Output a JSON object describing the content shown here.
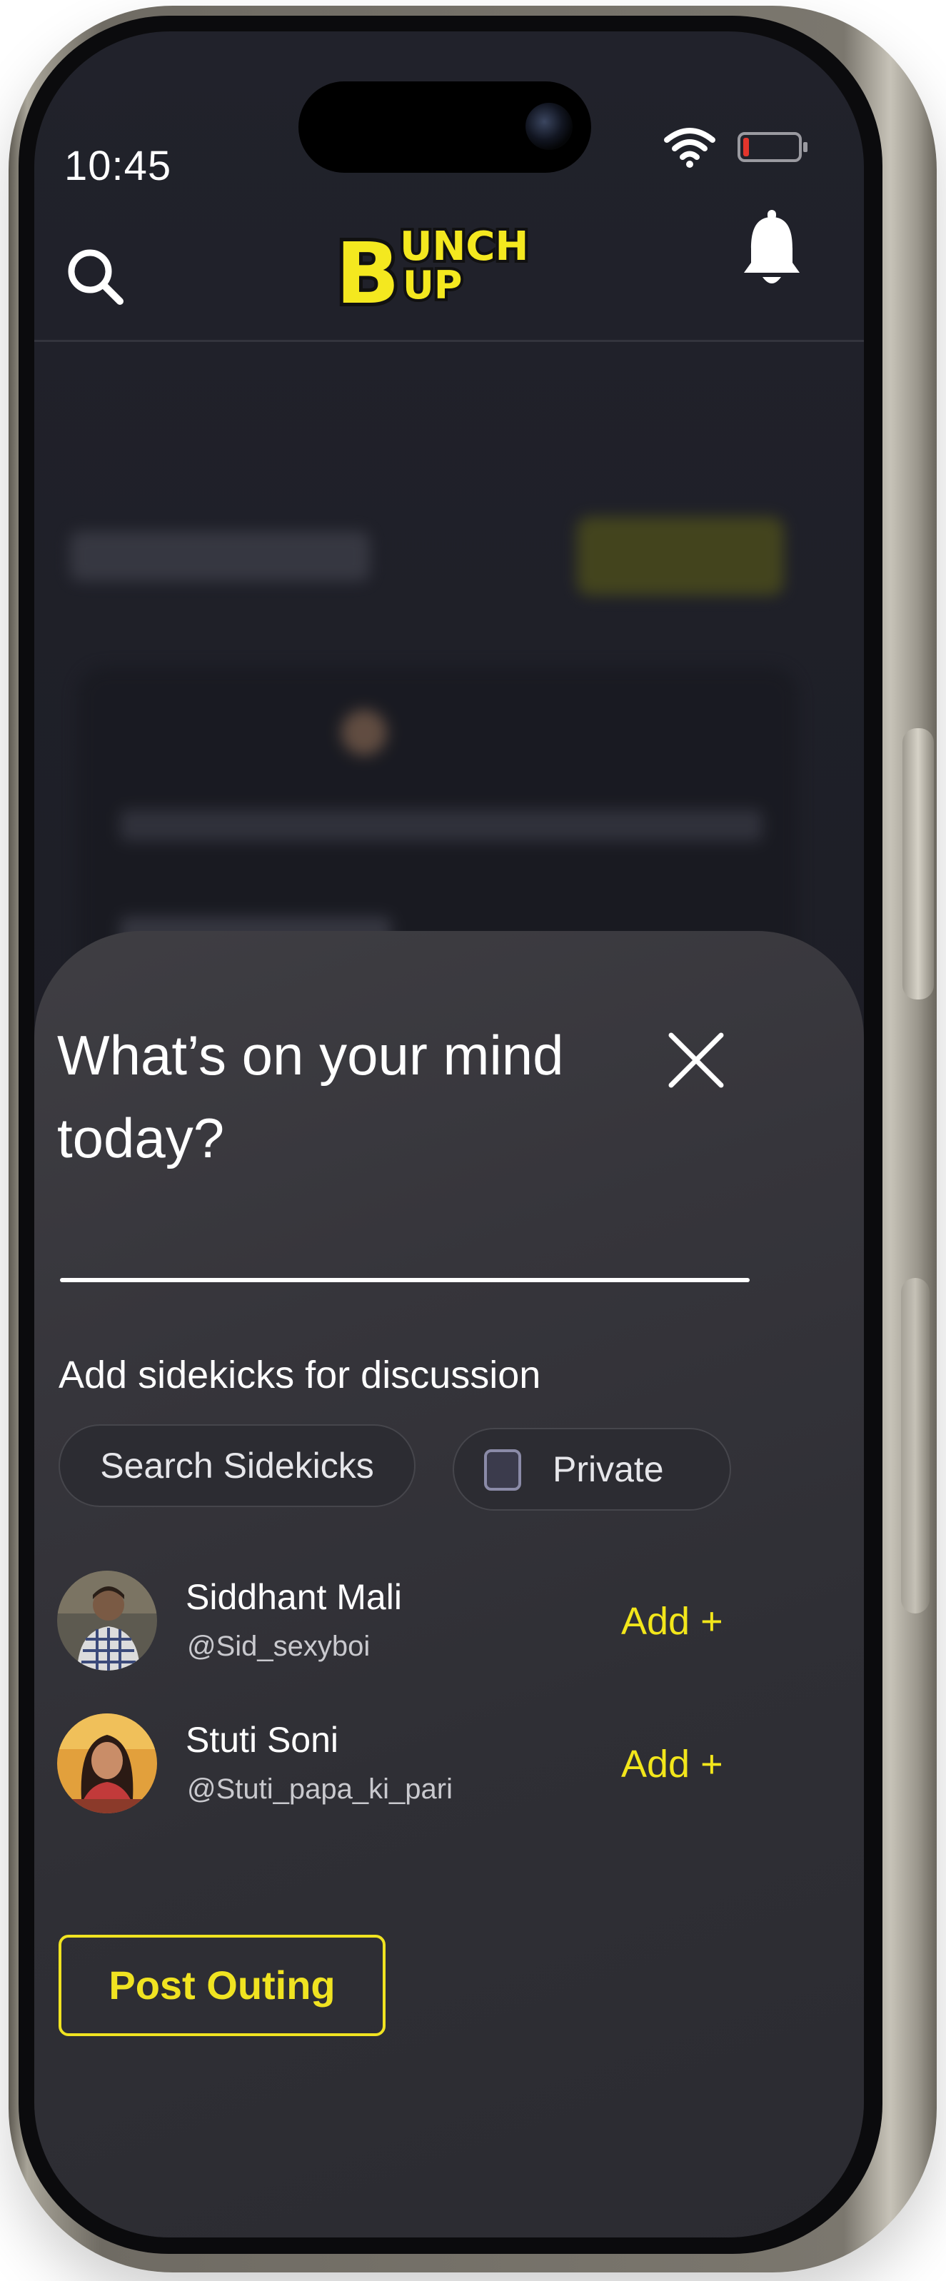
{
  "status_bar": {
    "time": "10:45",
    "icons": [
      "wifi-icon",
      "battery-icon"
    ]
  },
  "header": {
    "logo_text_1": "B",
    "logo_text_2": "UNCH",
    "logo_text_3": "UP",
    "icons": [
      "search-icon",
      "bell-icon"
    ]
  },
  "sheet": {
    "title": "What’s on your mind today?",
    "close_icon": "close-icon",
    "sidekicks_label": "Add sidekicks for discussion",
    "search_placeholder": "Search Sidekicks",
    "private_label": "Private",
    "private_checked": false,
    "sidekicks": [
      {
        "name": "Siddhant Mali",
        "handle": "@Sid_sexyboi",
        "action": "Add +"
      },
      {
        "name": "Stuti Soni",
        "handle": "@Stuti_papa_ki_pari",
        "action": "Add +"
      }
    ],
    "post_button": "Post Outing"
  },
  "colors": {
    "accent": "#f0e321",
    "background": "#21222b",
    "sheet": "#35353b"
  }
}
